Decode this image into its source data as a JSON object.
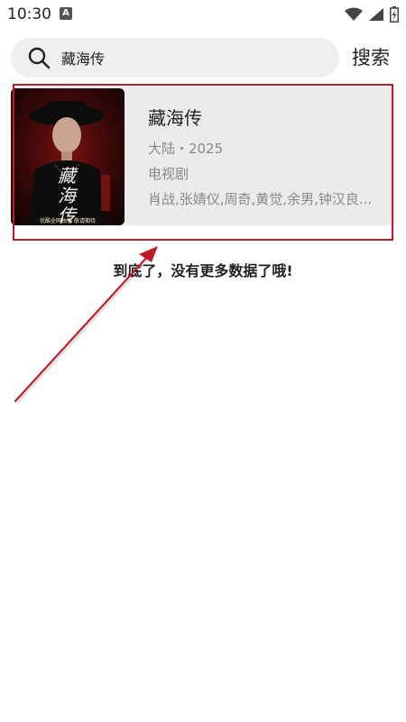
{
  "status_bar": {
    "time": "10:30",
    "notification_letter": "A"
  },
  "search": {
    "query": "藏海传",
    "button_label": "搜索"
  },
  "results": [
    {
      "title": "藏海传",
      "meta": "大陆・2025",
      "type": "电视剧",
      "cast": "肖战,张婧仪,周奇,黄觉,余男,钟汉良...",
      "poster_title": "藏海传",
      "poster_tagline": "优酷全网独播 敬请期待"
    }
  ],
  "footer": {
    "end_message": "到底了，没有更多数据了哦!"
  },
  "colors": {
    "annotation": "#c11a27"
  }
}
